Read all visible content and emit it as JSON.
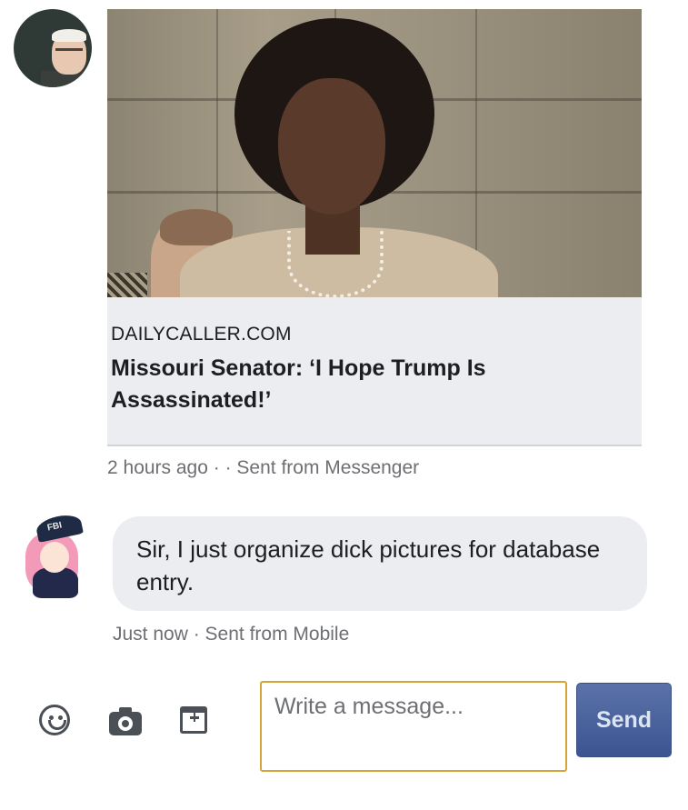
{
  "conversation": {
    "shared_link": {
      "domain": "DAILYCALLER.COM",
      "headline": "Missouri Senator: ‘I Hope Trump Is Assassinated!’",
      "meta": "2 hours ago · · Sent from Messenger"
    },
    "reply": {
      "text": "Sir, I just organize dick pictures for database entry.",
      "meta": "Just now · Sent from Mobile",
      "avatar_badge": "FBI"
    }
  },
  "composer": {
    "placeholder": "Write a message...",
    "send_label": "Send",
    "icons": [
      "emoji-icon",
      "camera-icon",
      "sticker-icon"
    ]
  },
  "colors": {
    "bubble": "#ebedf0",
    "input_border": "#d4a43a",
    "send_button": "#3c5592"
  }
}
